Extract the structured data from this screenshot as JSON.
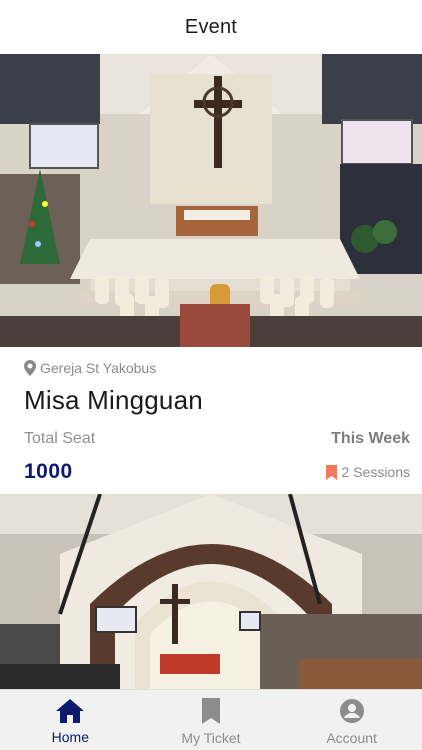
{
  "header": {
    "title": "Event"
  },
  "events": [
    {
      "location": "Gereja St Yakobus",
      "title": "Misa Mingguan",
      "seat_label": "Total Seat",
      "seat_value": "1000",
      "period_label": "This Week",
      "sessions_label": "2 Sessions"
    }
  ],
  "colors": {
    "accent": "#0d1b6b",
    "muted": "#8a8a8a",
    "bookmark": "#f07a5a",
    "nav_bg": "#f1f1f1"
  },
  "nav": {
    "items": [
      {
        "label": "Home",
        "icon": "home-icon",
        "active": true
      },
      {
        "label": "My Ticket",
        "icon": "bookmark-icon",
        "active": false
      },
      {
        "label": "Account",
        "icon": "account-icon",
        "active": false
      }
    ]
  }
}
